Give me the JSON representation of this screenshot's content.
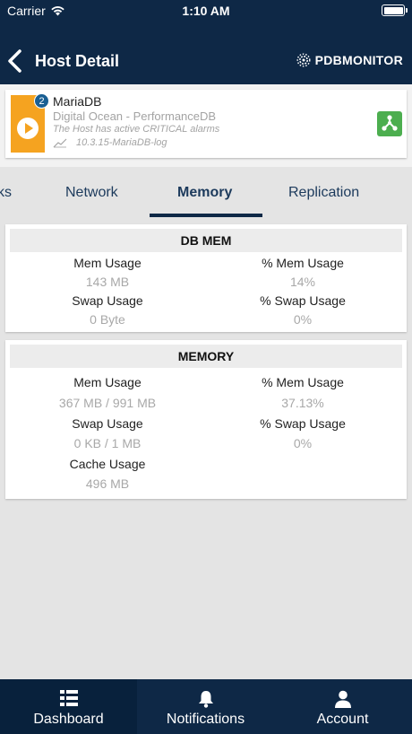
{
  "status_bar": {
    "carrier": "Carrier",
    "time": "1:10 AM"
  },
  "nav": {
    "title": "Host Detail",
    "brand": "PDBMONITOR"
  },
  "host": {
    "badge": "2",
    "name": "MariaDB",
    "subtitle": "Digital Ocean - PerformanceDB",
    "alert": "The Host has active CRITICAL alarms",
    "version": "10.3.15-MariaDB-log",
    "icon": "play-icon",
    "accent": "#f5a320",
    "topology_color": "#4cae4f"
  },
  "tabs": {
    "items": [
      "ks",
      "Network",
      "Memory",
      "Replication"
    ],
    "active": "Memory"
  },
  "db_mem": {
    "title": "DB MEM",
    "mem_usage_label": "Mem Usage",
    "mem_usage_value": "143 MB",
    "pct_mem_usage_label": "% Mem Usage",
    "pct_mem_usage_value": "14%",
    "swap_usage_label": "Swap Usage",
    "swap_usage_value": "0 Byte",
    "pct_swap_usage_label": "% Swap Usage",
    "pct_swap_usage_value": "0%"
  },
  "memory": {
    "title": "MEMORY",
    "mem_usage_label": "Mem Usage",
    "mem_usage_value": "367 MB / 991 MB",
    "pct_mem_usage_label": "% Mem Usage",
    "pct_mem_usage_value": "37.13%",
    "swap_usage_label": "Swap Usage",
    "swap_usage_value": "0 KB / 1 MB",
    "pct_swap_usage_label": "% Swap Usage",
    "pct_swap_usage_value": "0%",
    "cache_usage_label": "Cache Usage",
    "cache_usage_value": "496 MB"
  },
  "bottom_nav": {
    "dashboard": "Dashboard",
    "notifications": "Notifications",
    "account": "Account",
    "active": "Dashboard"
  },
  "colors": {
    "header_bg": "#0e2846",
    "page_bg": "#e4e4e4"
  }
}
